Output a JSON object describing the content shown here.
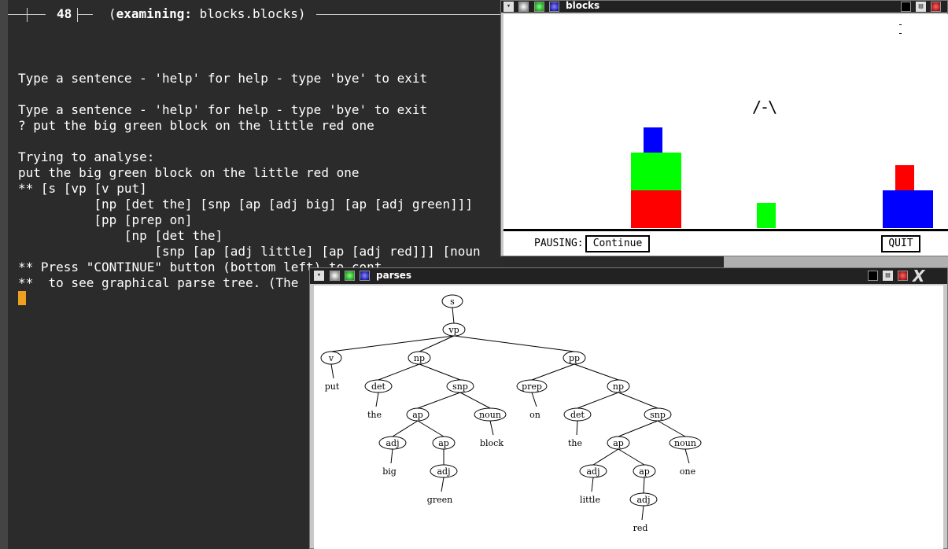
{
  "terminal": {
    "header_number": "48",
    "header_status_prefix": "(",
    "header_status_bold": "examining:",
    "header_status_rest": " blocks.blocks)",
    "lines": [
      "Type a sentence - 'help' for help - type 'bye' to exit",
      "",
      "Type a sentence - 'help' for help - type 'bye' to exit",
      "? put the big green block on the little red one",
      "",
      "Trying to analyse:",
      "put the big green block on the little red one",
      "** [s [vp [v put]",
      "          [np [det the] [snp [ap [adj big] [ap [adj green]]]",
      "          [pp [prep on]",
      "              [np [det the]",
      "                  [snp [ap [adj little] [ap [adj red]]] [noun",
      "** Press \"CONTINUE\" button (bottom left) to cont",
      "**  to see graphical parse tree. (The"
    ],
    "colors": {
      "background": "#2b2b2b",
      "text": "#ffffff",
      "cursor": "#f0a020"
    }
  },
  "blocks_window": {
    "title": "blocks",
    "hand_glyph": "/-\\",
    "pausing_label": "PAUSING:",
    "continue_label": "Continue",
    "quit_label": "QUIT",
    "blocks": [
      {
        "color": "#ff0000",
        "name": "big-red-block-left"
      },
      {
        "color": "#00ff00",
        "name": "big-green-block"
      },
      {
        "color": "#0000ff",
        "name": "small-blue-block-top"
      },
      {
        "color": "#00ff00",
        "name": "small-green-block"
      },
      {
        "color": "#0000ff",
        "name": "big-blue-block-right"
      },
      {
        "color": "#ff0000",
        "name": "little-red-block"
      }
    ]
  },
  "parses_window": {
    "title": "parses",
    "tree": {
      "nodes": {
        "s": "s",
        "vp": "vp",
        "v": "v",
        "np1": "np",
        "pp": "pp",
        "det1": "det",
        "snp1": "snp",
        "prep": "prep",
        "np2": "np",
        "ap1": "ap",
        "noun1": "noun",
        "det2": "det",
        "snp2": "snp",
        "adj1": "adj",
        "ap2": "ap",
        "ap3": "ap",
        "noun2": "noun",
        "adj2": "adj",
        "adj3": "adj",
        "ap4": "ap",
        "adj4": "adj"
      },
      "words": {
        "put": "put",
        "the1": "the",
        "block": "block",
        "on": "on",
        "the2": "the",
        "big": "big",
        "one": "one",
        "green": "green",
        "little": "little",
        "red": "red"
      }
    }
  }
}
